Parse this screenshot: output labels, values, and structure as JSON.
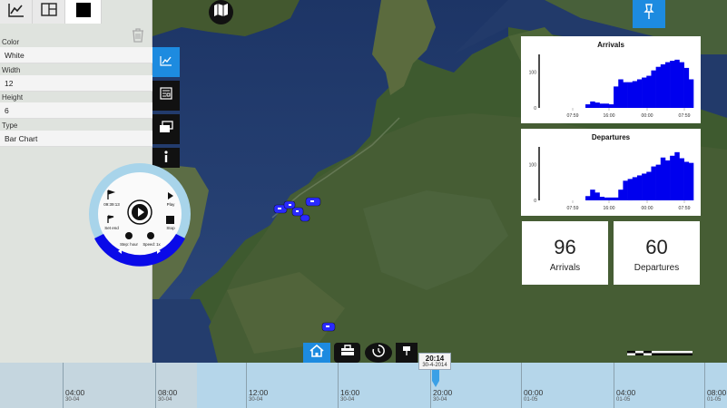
{
  "panel": {
    "tabs": [
      "chart-tab",
      "layout-tab",
      "color-swatch-tab"
    ],
    "fields": [
      {
        "label": "Color",
        "value": "White"
      },
      {
        "label": "Width",
        "value": "12"
      },
      {
        "label": "Height",
        "value": "6"
      },
      {
        "label": "Type",
        "value": "Bar Chart"
      }
    ]
  },
  "radial_control": {
    "time": "09:39:13",
    "play_label": "Play",
    "stop_label": "Stop",
    "set_end_label": "Set end",
    "step_label": "Step: hour",
    "speed_label": "Speed: 1x"
  },
  "arrivals_chart": {
    "title": "Arrivals",
    "chart_data": {
      "type": "bar",
      "title": "Arrivals",
      "x_tick_labels": [
        "07:59",
        "16:00",
        "00:00",
        "07:59"
      ],
      "y_tick_labels": [
        "0",
        "100"
      ],
      "ylim": [
        0,
        160
      ],
      "values": [
        10,
        18,
        15,
        12,
        12,
        10,
        60,
        80,
        72,
        72,
        75,
        80,
        85,
        90,
        105,
        115,
        122,
        128,
        132,
        135,
        128,
        112,
        80,
        0,
        0,
        0,
        0,
        0,
        0,
        0
      ],
      "values_ordered": [
        0,
        0,
        0,
        0,
        0,
        0,
        10,
        18,
        15,
        12,
        12,
        10,
        60,
        80,
        72,
        72,
        75,
        80,
        85,
        90,
        105,
        115,
        122,
        128,
        132,
        135,
        128,
        112,
        80
      ],
      "color": "#0000ee"
    }
  },
  "departures_chart": {
    "title": "Departures",
    "chart_data": {
      "type": "bar",
      "title": "Departures",
      "x_tick_labels": [
        "07:59",
        "16:00",
        "00:00",
        "07:59"
      ],
      "y_tick_labels": [
        "0",
        "100"
      ],
      "ylim": [
        0,
        160
      ],
      "values": [
        0,
        0,
        0,
        0,
        0,
        0,
        12,
        30,
        22,
        10,
        8,
        8,
        8,
        30,
        55,
        60,
        65,
        70,
        75,
        80,
        95,
        100,
        120,
        112,
        125,
        135,
        118,
        108,
        105
      ],
      "color": "#0000ee"
    }
  },
  "kpis": [
    {
      "value": "96",
      "label": "Arrivals"
    },
    {
      "value": "60",
      "label": "Departures"
    }
  ],
  "timeline": {
    "ticks": [
      {
        "time": "04:00",
        "date": "30-04"
      },
      {
        "time": "08:00",
        "date": "30-04"
      },
      {
        "time": "12:00",
        "date": "30-04"
      },
      {
        "time": "16:00",
        "date": "30-04"
      },
      {
        "time": "20:00",
        "date": "30-04"
      },
      {
        "time": "00:00",
        "date": "01-05"
      },
      {
        "time": "04:00",
        "date": "01-05"
      },
      {
        "time": "08:00",
        "date": "01-05"
      }
    ],
    "cursor_time": "20:14",
    "cursor_date": "30-4-2014"
  },
  "colors": {
    "accent": "#1d8be0",
    "bars": "#0000ee",
    "vessel": "#2a2aff"
  }
}
